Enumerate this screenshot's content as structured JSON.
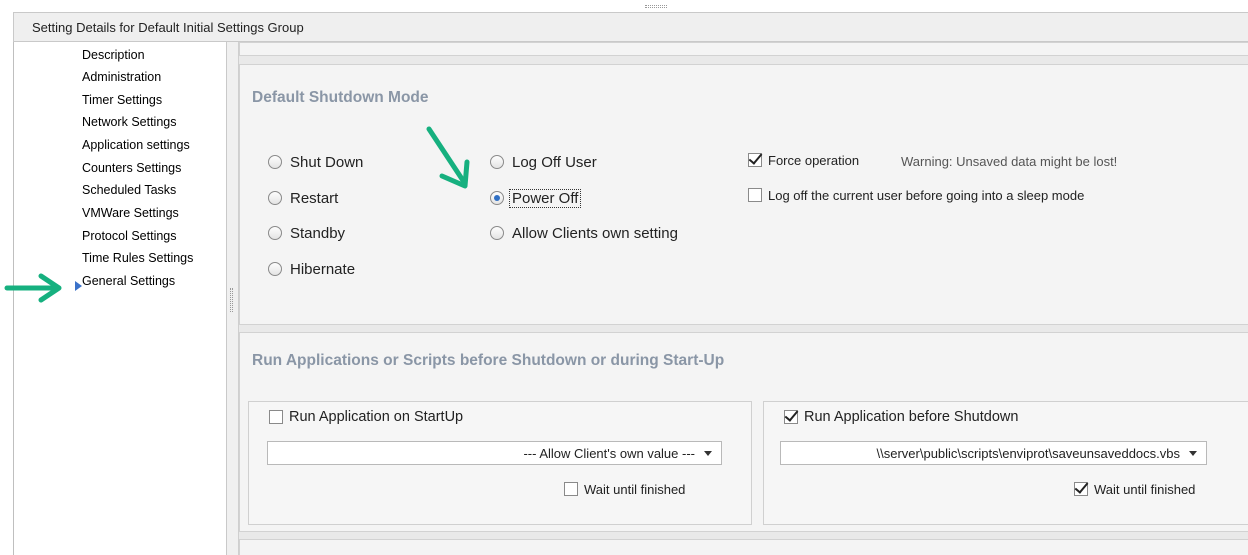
{
  "header": {
    "title": "Setting Details for Default Initial Settings Group"
  },
  "nav": {
    "items": [
      "Description",
      "Administration",
      "Timer Settings",
      "Network Settings",
      "Application settings",
      "Counters Settings",
      "Scheduled Tasks",
      "VMWare Settings",
      "Protocol Settings",
      "Time Rules Settings",
      "General Settings"
    ],
    "selected": "General Settings"
  },
  "shutdown": {
    "title": "Default Shutdown Mode",
    "options": [
      "Shut Down",
      "Restart",
      "Standby",
      "Hibernate",
      "Log Off User",
      "Power Off",
      "Allow Clients own setting"
    ],
    "selected": "Power Off",
    "force_label": "Force operation",
    "force_checked": true,
    "warning": "Warning: Unsaved data might be lost!",
    "logoff_label": "Log off the current user before going into a sleep mode",
    "logoff_checked": false
  },
  "run": {
    "title": "Run Applications or Scripts before Shutdown or during Start-Up",
    "startup": {
      "label": "Run Application on  StartUp",
      "checked": false,
      "value": "--- Allow Client's own value ---",
      "wait_label": "Wait until finished",
      "wait_checked": false
    },
    "shutdown": {
      "label": "Run Application before Shutdown",
      "checked": true,
      "value": "\\\\server\\public\\scripts\\enviprot\\saveunsaveddocs.vbs",
      "wait_label": "Wait until finished",
      "wait_checked": true
    }
  },
  "colors": {
    "accent_arrow": "#16b07f",
    "section_title": "#8a96a6",
    "radio_dot": "#2f6fc4"
  }
}
